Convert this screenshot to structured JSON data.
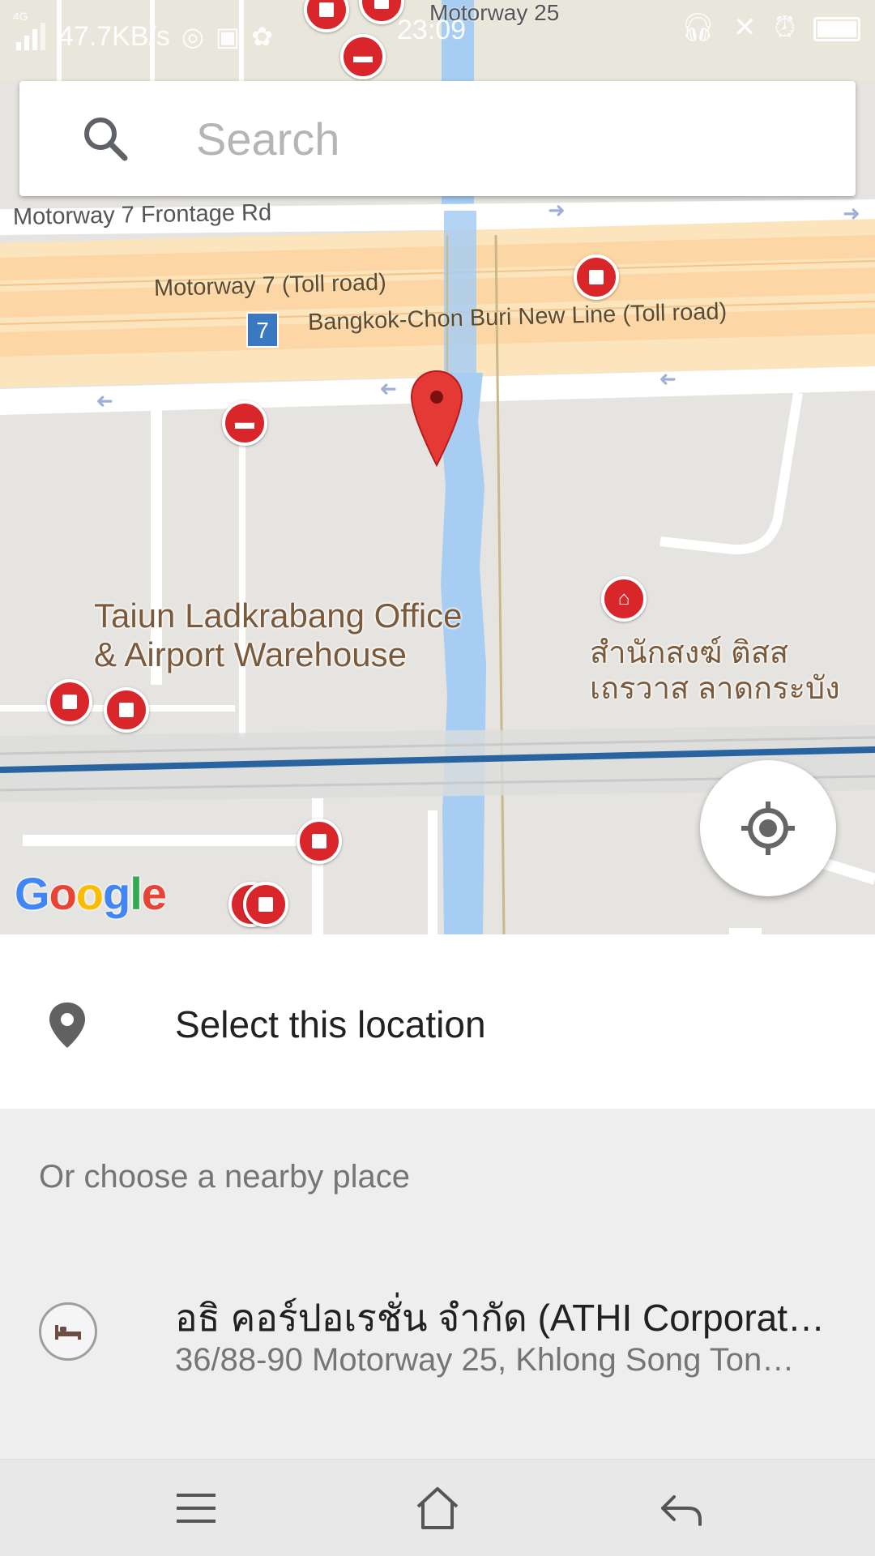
{
  "status_bar": {
    "network": "4G",
    "speed": "47.7KB/s",
    "time": "23:09",
    "icons": [
      "signal-icon",
      "hotspot-icon",
      "image-icon",
      "sync-icon",
      "headphones-icon",
      "mute-icon",
      "alarm-icon",
      "battery-icon"
    ]
  },
  "search": {
    "placeholder": "Search",
    "icon": "search-icon"
  },
  "map": {
    "roads": {
      "frontage": "Motorway 7 Frontage Rd",
      "motorway": "Motorway 7 (Toll road)",
      "bangkok": "Bangkok-Chon Buri New Line (Toll road)",
      "top_road": "Motorway 25",
      "route_shield": "7"
    },
    "places": {
      "taiun_line1": "Taiun Ladkrabang Office",
      "taiun_line2": "& Airport Warehouse",
      "temple_line1": "สำนักสงฆ์ ติสส",
      "temple_line2": "เถรวาส ลาดกระบัง"
    },
    "logo": "Google",
    "colors": {
      "water": "#a7cdf2",
      "motorway": "#fcd6a4",
      "marker": "#d8262a",
      "railway": "#2a64a0"
    }
  },
  "select_location": {
    "label": "Select this location",
    "icon": "pin-icon"
  },
  "nearby": {
    "heading": "Or choose a nearby place",
    "items": [
      {
        "name": "อธิ คอร์ปอเรชั่น จำกัด (ATHI Corporati…",
        "address": "36/88-90 Motorway 25, Khlong Song Ton…",
        "icon": "hotel-icon"
      }
    ]
  },
  "nav_bar": {
    "buttons": [
      "menu-icon",
      "home-icon",
      "back-icon"
    ]
  }
}
